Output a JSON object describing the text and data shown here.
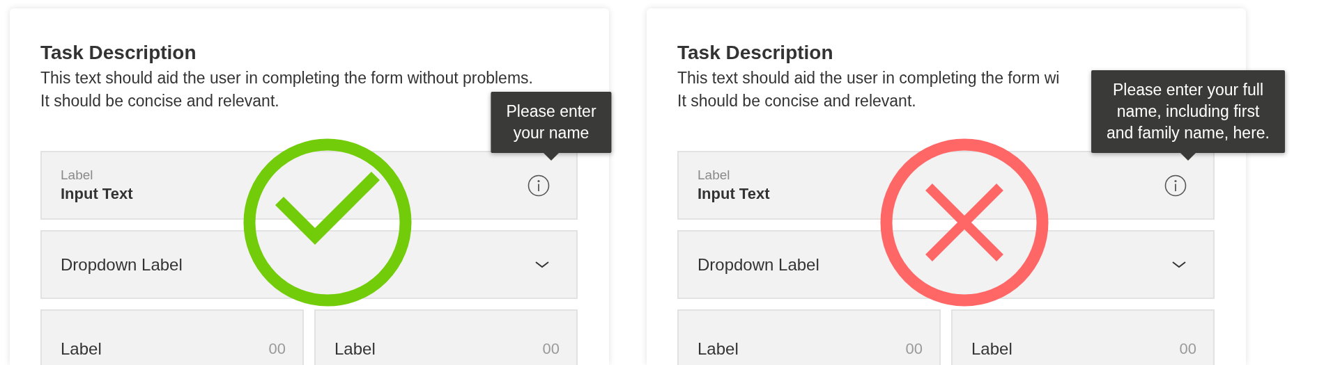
{
  "cards": [
    {
      "kind": "check",
      "title": "Task Description",
      "description_lines": [
        "This text should aid the user in completing the form without problems.",
        "It should be concise and relevant."
      ],
      "tooltip_lines": [
        "Please enter",
        "your name"
      ],
      "input": {
        "label": "Label",
        "value": "Input Text"
      },
      "dropdown": {
        "label": "Dropdown Label"
      },
      "counters": [
        {
          "label": "Label",
          "value": "00"
        },
        {
          "label": "Label",
          "value": "00"
        }
      ]
    },
    {
      "kind": "cross",
      "title": "Task Description",
      "description_lines": [
        "This text should aid the user in completing the form wi",
        "It should be concise and relevant."
      ],
      "tooltip_lines": [
        "Please enter your full",
        "name, including first",
        "and family name, here."
      ],
      "input": {
        "label": "Label",
        "value": "Input Text"
      },
      "dropdown": {
        "label": "Dropdown Label"
      },
      "counters": [
        {
          "label": "Label",
          "value": "00"
        },
        {
          "label": "Label",
          "value": "00"
        }
      ]
    }
  ]
}
